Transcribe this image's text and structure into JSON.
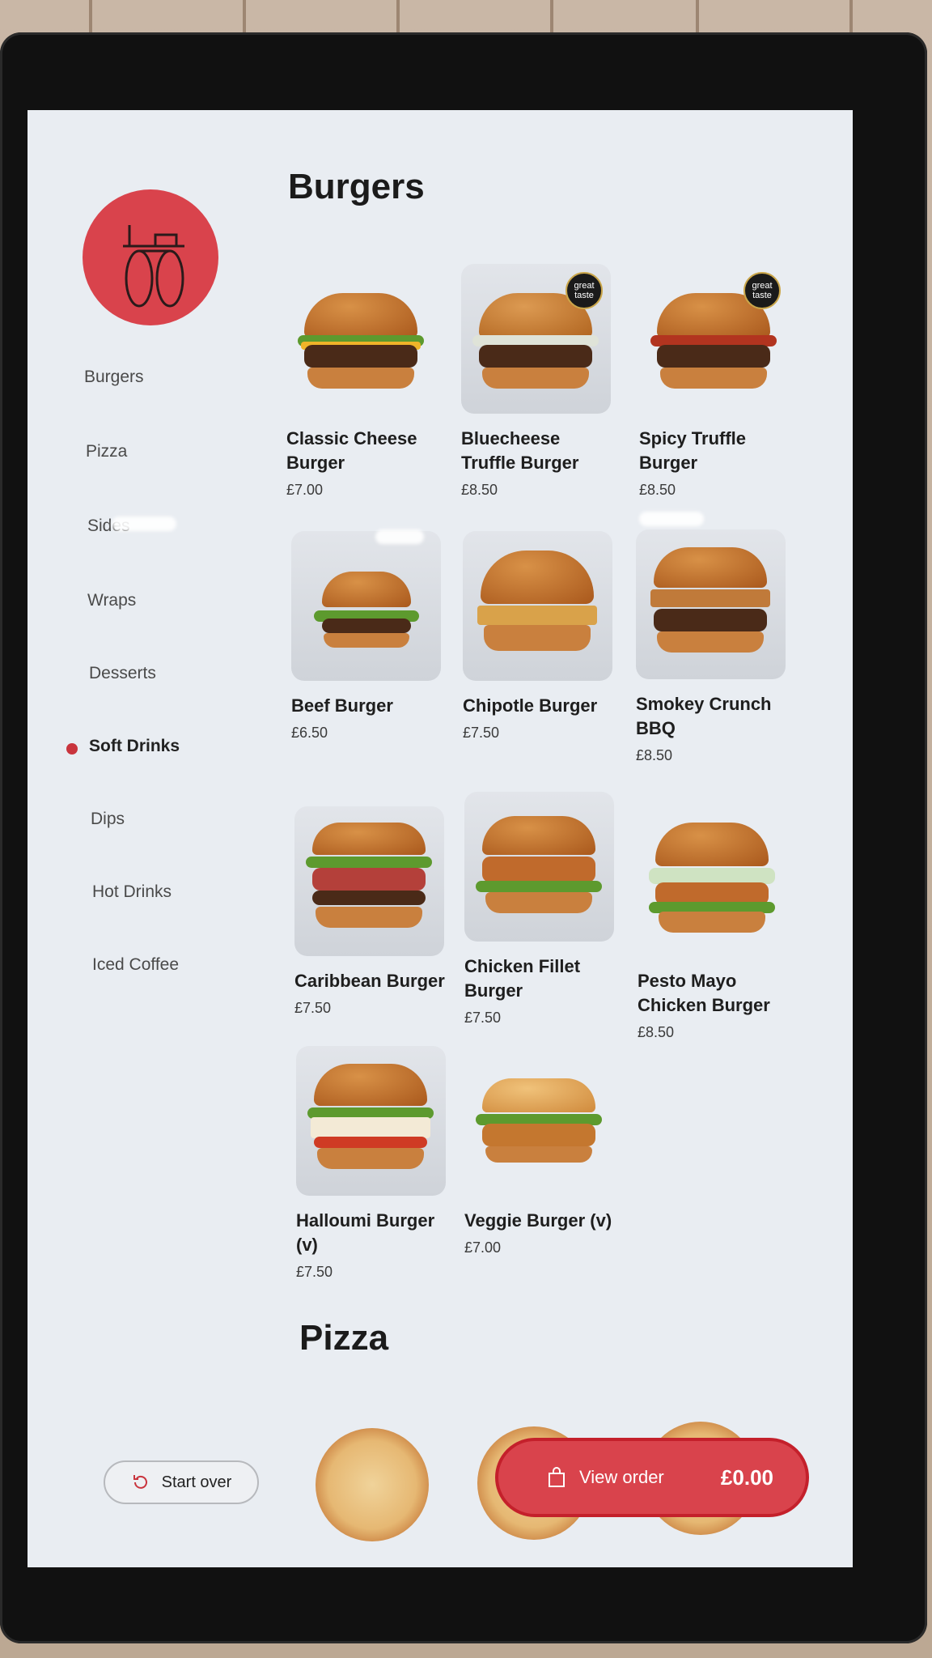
{
  "sidebar": {
    "items": [
      {
        "label": "Burgers"
      },
      {
        "label": "Pizza"
      },
      {
        "label": "Sides"
      },
      {
        "label": "Wraps"
      },
      {
        "label": "Desserts"
      },
      {
        "label": "Soft Drinks"
      },
      {
        "label": "Dips"
      },
      {
        "label": "Hot Drinks"
      },
      {
        "label": "Iced Coffee"
      }
    ],
    "active": "Soft Drinks"
  },
  "sections": {
    "burgers_title": "Burgers",
    "pizza_title": "Pizza"
  },
  "burgers": [
    {
      "name": "Classic Cheese Burger",
      "price": "£7.00",
      "award": ""
    },
    {
      "name": "Bluecheese Truffle Burger",
      "price": "£8.50",
      "award": "great taste"
    },
    {
      "name": "Spicy Truffle Burger",
      "price": "£8.50",
      "award": "great taste"
    },
    {
      "name": "Beef Burger",
      "price": "£6.50",
      "award": ""
    },
    {
      "name": "Chipotle Burger",
      "price": "£7.50",
      "award": ""
    },
    {
      "name": "Smokey Crunch BBQ",
      "price": "£8.50",
      "award": ""
    },
    {
      "name": "Caribbean Burger",
      "price": "£7.50",
      "award": ""
    },
    {
      "name": "Chicken Fillet Burger",
      "price": "£7.50",
      "award": ""
    },
    {
      "name": "Pesto Mayo Chicken Burger",
      "price": "£8.50",
      "award": ""
    },
    {
      "name": "Halloumi Burger (v)",
      "price": "£7.50",
      "award": ""
    },
    {
      "name": "Veggie Burger (v)",
      "price": "£7.00",
      "award": ""
    }
  ],
  "footer": {
    "start_over": "Start over",
    "view_order": "View order",
    "total": "£0.00"
  },
  "colors": {
    "accent": "#d9434c",
    "screen_bg": "#e9edf2"
  },
  "icons": {
    "start_over": "restart-icon",
    "view_order": "shopping-bag-icon",
    "logo": "bicycle-logo"
  }
}
